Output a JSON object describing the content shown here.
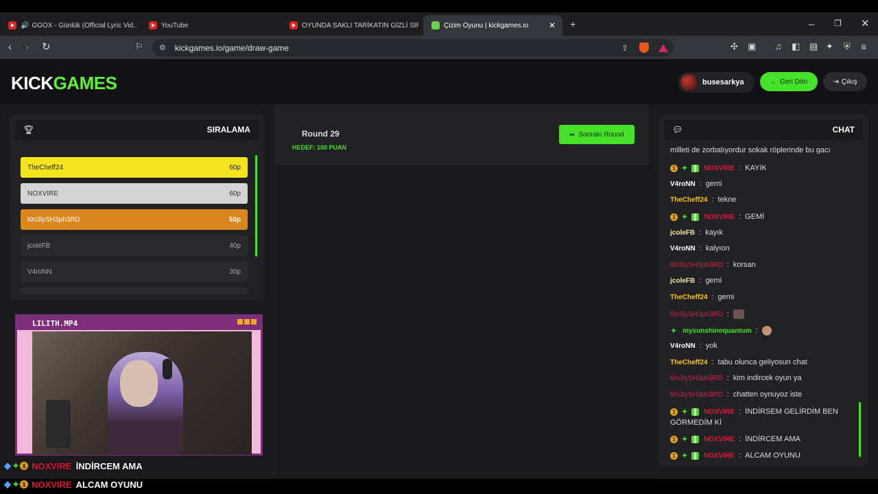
{
  "browser": {
    "tabs": [
      {
        "title": "GGOX - Günlük (Official Lyric Vid..."
      },
      {
        "title": "YouTube"
      },
      {
        "title": "OYUNDA SAKLI TARİKATIN GİZLİ SIR..."
      },
      {
        "title": "Çizim Oyunu | kickgames.io"
      }
    ],
    "new_tab": "+",
    "url": "kickgames.io/game/draw-game"
  },
  "header": {
    "logo_kick": "KICK",
    "logo_games": "GAMES",
    "username": "busesarkya",
    "back_label": "Geri Dön",
    "logout_label": "Çıkış"
  },
  "ranking": {
    "title": "SIRALAMA",
    "rows": [
      {
        "name": "TheCheff24",
        "points": "60p"
      },
      {
        "name": "NOXVIRE",
        "points": "60p"
      },
      {
        "name": "l0n3lySH3ph3RD",
        "points": "50p"
      },
      {
        "name": "jcoleFB",
        "points": "40p"
      },
      {
        "name": "V4roNN",
        "points": "30p"
      }
    ]
  },
  "game": {
    "round_label": "Round 29",
    "target_label": "HEDEF: 100 PUAN",
    "next_round_label": "Sonraki Round"
  },
  "chat": {
    "title": "CHAT",
    "truncated_top": "milleti de zorbalıyordur sokak röplerinde bu gacı",
    "messages": [
      {
        "user": "NOXVIRE",
        "text": "KAYIK"
      },
      {
        "user": "V4roNN",
        "text": "gemi"
      },
      {
        "user": "TheCheff24",
        "text": "tekne"
      },
      {
        "user": "NOXVIRE",
        "text": "GEMİ"
      },
      {
        "user": "jcoleFB",
        "text": "kayık"
      },
      {
        "user": "V4roNN",
        "text": "kalyıon"
      },
      {
        "user": "l0n3lySH3ph3RD",
        "text": "korsan"
      },
      {
        "user": "jcoleFB",
        "text": "gemi"
      },
      {
        "user": "TheCheff24",
        "text": "gemi"
      },
      {
        "user": "l0n3lySH3ph3RD",
        "text": ""
      },
      {
        "user": "mysunshinequantum",
        "text": ""
      },
      {
        "user": "V4roNN",
        "text": "yok"
      },
      {
        "user": "TheCheff24",
        "text": "tabu olunca geliyosun chat"
      },
      {
        "user": "l0n3lySH3ph3RD",
        "text": "kim indircek oyun ya"
      },
      {
        "user": "l0n3lySH3ph3RD",
        "text": "chatten oynuyoz iste"
      },
      {
        "user": "NOXVIRE",
        "text": "İNDİRSEM GELİRDİM BEN",
        "text2": "GÖRMEDİM Kİ"
      },
      {
        "user": "NOXVIRE",
        "text": "İNDİRCEM AMA"
      },
      {
        "user": "NOXVIRE",
        "text": "ALCAM OYUNU"
      }
    ],
    "separator": ":"
  },
  "stream": {
    "cam_title": "LILITH.MP4",
    "overlay": [
      {
        "user": "NOXVIRE",
        "text": "İNDİRCEM AMA"
      },
      {
        "user": "NOXVIRE",
        "text": "ALCAM OYUNU"
      }
    ]
  },
  "colors": {
    "accent": "#46e12a",
    "gold": "#f5d327",
    "silver": "#cfcfcf",
    "bronze": "#d9861e",
    "noxvire": "#e0143c",
    "thecheff": "#f5c518",
    "shepherd": "#d0244a"
  }
}
